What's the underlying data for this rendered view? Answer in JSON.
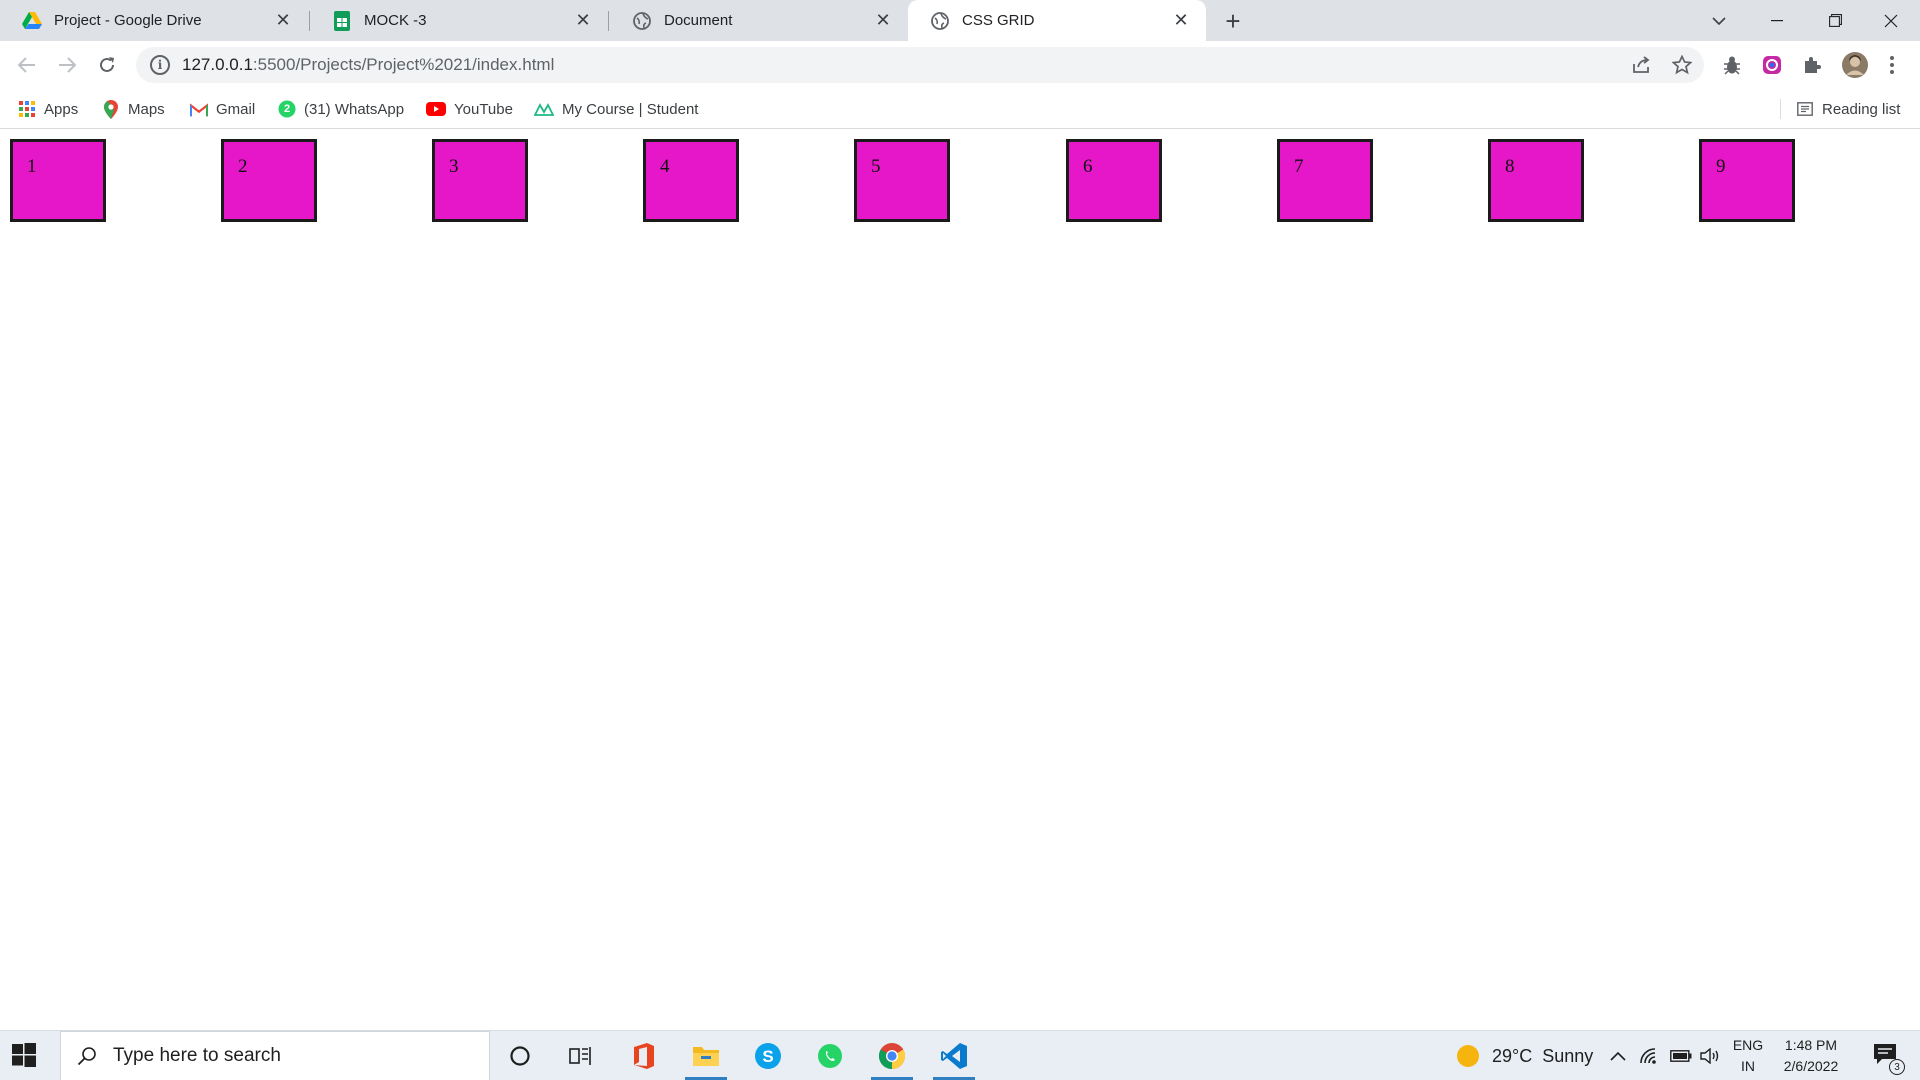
{
  "browser": {
    "tabs": [
      {
        "title": "Project - Google Drive",
        "icon": "google-drive-icon"
      },
      {
        "title": "MOCK -3",
        "icon": "google-sheets-icon"
      },
      {
        "title": "Document",
        "icon": "globe-icon"
      },
      {
        "title": "CSS GRID",
        "icon": "globe-icon",
        "active": true
      }
    ],
    "close_glyph": "✕",
    "new_tab_glyph": "+",
    "url_host": "127.0.0.1",
    "url_path": ":5500/Projects/Project%2021/index.html",
    "bookmarks": [
      {
        "label": "Apps",
        "icon": "apps-grid-icon"
      },
      {
        "label": "Maps",
        "icon": "maps-pin-icon"
      },
      {
        "label": "Gmail",
        "icon": "gmail-icon"
      },
      {
        "label": "(31) WhatsApp",
        "icon": "whatsapp-icon",
        "badge": "2"
      },
      {
        "label": "YouTube",
        "icon": "youtube-icon"
      },
      {
        "label": "My Course | Student",
        "icon": "course-logo-icon"
      }
    ],
    "reading_list": "Reading list"
  },
  "page": {
    "cells": [
      "1",
      "2",
      "3",
      "4",
      "5",
      "6",
      "7",
      "8",
      "9"
    ],
    "cell_color": "#e616c9"
  },
  "taskbar": {
    "search_placeholder": "Type here to search",
    "weather": "29°C  Sunny",
    "language_line1": "ENG",
    "language_line2": "IN",
    "time": "1:48 PM",
    "date": "2/6/2022",
    "notification_count": "3"
  }
}
